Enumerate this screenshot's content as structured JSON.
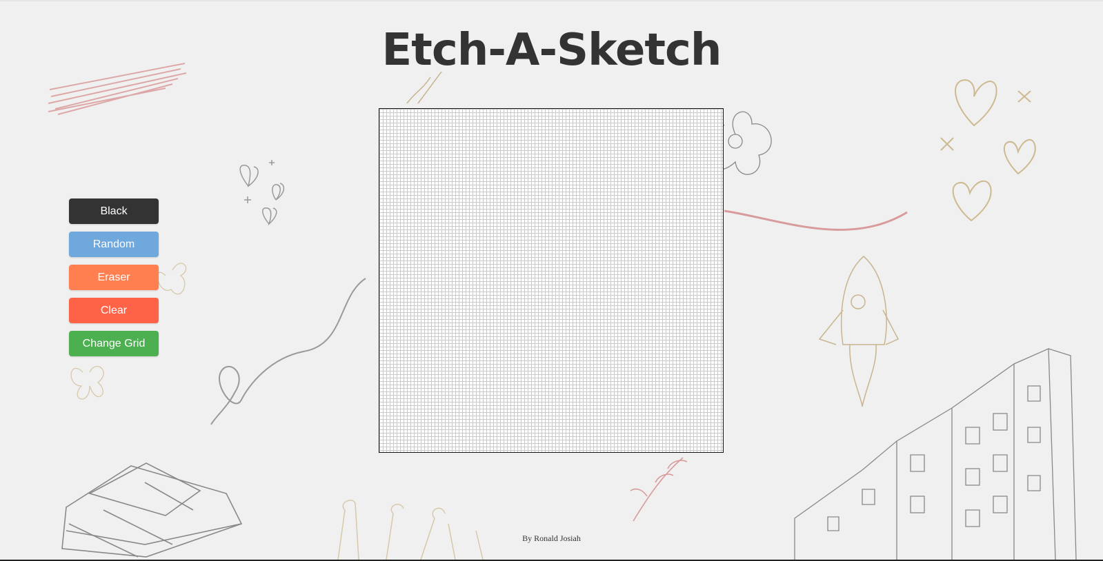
{
  "header": {
    "title": "Etch-A-Sketch"
  },
  "controls": {
    "buttons": [
      {
        "label": "Black",
        "color": "#333333"
      },
      {
        "label": "Random",
        "color": "#6fa8dc"
      },
      {
        "label": "Eraser",
        "color": "#ff7f50"
      },
      {
        "label": "Clear",
        "color": "#ff6347"
      },
      {
        "label": "Change Grid",
        "color": "#4caf50"
      }
    ]
  },
  "grid": {
    "cells_per_side": 100,
    "cell_color": "#ffffff",
    "line_color": "#c9c9c9"
  },
  "footer": {
    "credit": "By Ronald Josiah"
  },
  "background": {
    "color": "#f0f0f0"
  }
}
